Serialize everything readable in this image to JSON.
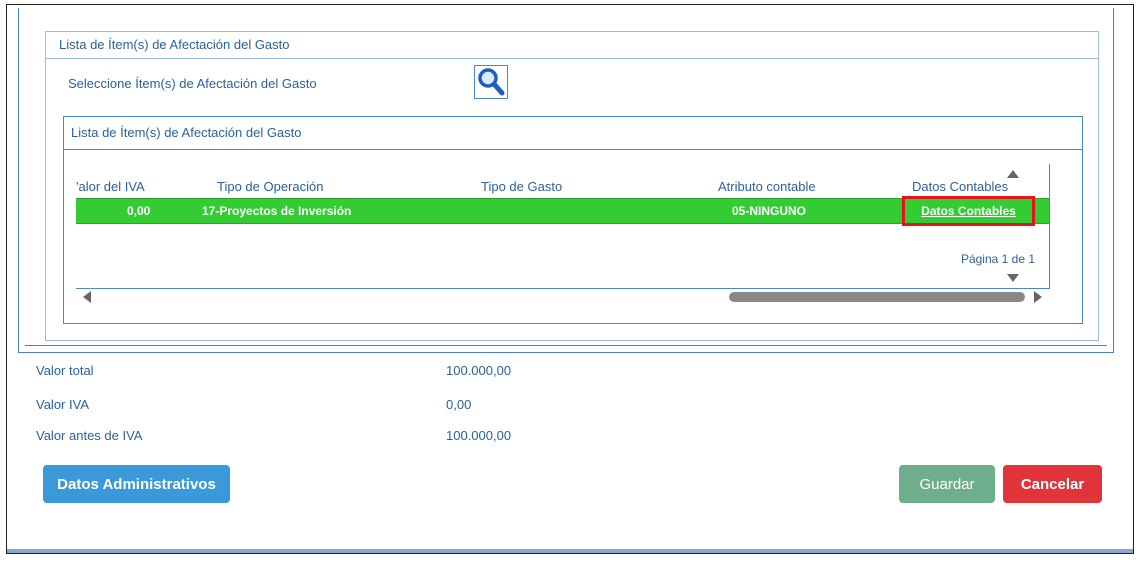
{
  "outer_section": {
    "title": "Lista de Ítem(s) de Afectación del Gasto",
    "selector_label": "Seleccione Ítem(s) de Afectación del Gasto",
    "search_icon": "search-icon"
  },
  "inner_section": {
    "title": "Lista de Ítem(s) de Afectación del Gasto"
  },
  "grid": {
    "columns": [
      "'alor del IVA",
      "Tipo de Operación",
      "Tipo de Gasto",
      "Atributo contable",
      "Datos Contables"
    ],
    "rows": [
      {
        "valor_iva": "0,00",
        "tipo_operacion": "17-Proyectos de Inversión",
        "tipo_gasto": "",
        "atributo_contable": "05-NINGUNO",
        "datos_contables": "Datos Contables"
      }
    ],
    "pager": "Página 1 de 1",
    "selected_row_color": "#33cc33",
    "highlight_color": "#e0161c"
  },
  "summary": [
    {
      "label": "Valor total",
      "value": "100.000,00"
    },
    {
      "label": "Valor IVA",
      "value": "0,00"
    },
    {
      "label": "Valor antes de IVA",
      "value": "100.000,00"
    }
  ],
  "buttons": {
    "admin": "Datos Administrativos",
    "save": "Guardar",
    "cancel": "Cancelar"
  }
}
